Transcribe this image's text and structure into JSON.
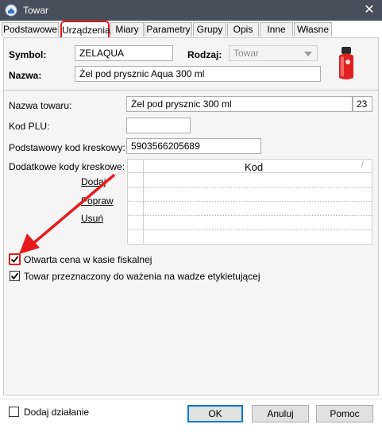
{
  "window": {
    "title": "Towar",
    "close_glyph": "✕"
  },
  "tabs": [
    {
      "label": "Podstawowe"
    },
    {
      "label": "Urządzenia"
    },
    {
      "label": "Miary"
    },
    {
      "label": "Parametry"
    },
    {
      "label": "Grupy"
    },
    {
      "label": "Opis"
    },
    {
      "label": "Inne"
    },
    {
      "label": "Własne"
    }
  ],
  "header": {
    "symbol_label": "Symbol:",
    "symbol_value": "ZELAQUA",
    "rodzaj_label": "Rodzaj:",
    "rodzaj_value": "Towar",
    "nazwa_label": "Nazwa:",
    "nazwa_value": "Żel pod prysznic Aqua 300 ml"
  },
  "form": {
    "nazwa_towaru_label": "Nazwa towaru:",
    "nazwa_towaru_value": "Żel pod prysznic 300 ml",
    "nazwa_towaru_count": "23",
    "kod_plu_label": "Kod PLU:",
    "kod_plu_value": "",
    "kod_kreskowy_label": "Podstawowy kod kreskowy:",
    "kod_kreskowy_value": "5903566205689",
    "dodatkowe_label": "Dodatkowe kody kreskowe:",
    "links": {
      "dodaj": "Dodaj",
      "popraw": "Popraw",
      "usun": "Usuń"
    },
    "grid": {
      "column_kod": "Kod",
      "sort_glyph": "/"
    },
    "checkbox_cena": {
      "label": "Otwarta cena w kasie fiskalnej",
      "checked": true
    },
    "checkbox_wazenie": {
      "label": "Towar przeznaczony do ważenia na wadze etykietującej",
      "checked": true
    }
  },
  "footer": {
    "dodaj_dzialanie": {
      "label": "Dodaj działanie",
      "checked": false
    },
    "ok": "OK",
    "anuluj": "Anuluj",
    "pomoc": "Pomoc"
  },
  "colors": {
    "annotation_red": "#e8191a",
    "titlebar": "#474f5a",
    "focus_blue": "#0078d7"
  }
}
